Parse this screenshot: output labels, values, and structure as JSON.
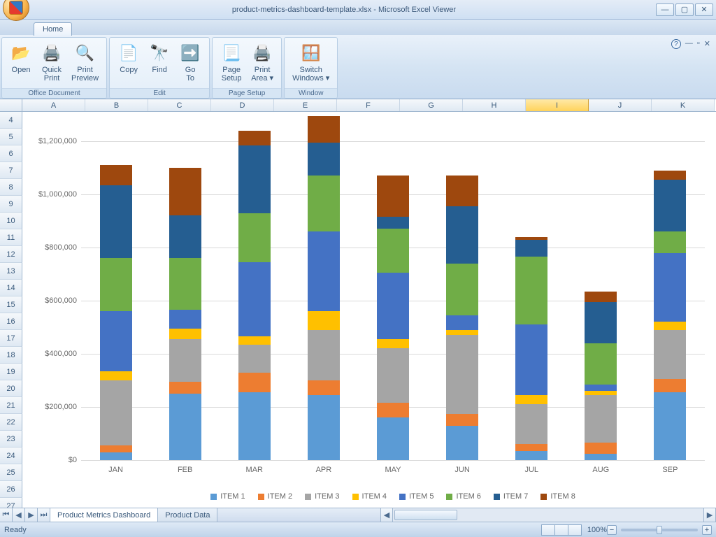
{
  "title": "product-metrics-dashboard-template.xlsx - Microsoft Excel Viewer",
  "tab": "Home",
  "groups": {
    "office_document": "Office Document",
    "edit": "Edit",
    "page_setup": "Page Setup",
    "window": "Window"
  },
  "buttons": {
    "open": "Open",
    "quick_print": "Quick\nPrint",
    "print_preview": "Print\nPreview",
    "copy": "Copy",
    "find": "Find",
    "goto": "Go\nTo",
    "page_setup": "Page\nSetup",
    "print_area": "Print\nArea ▾",
    "switch_windows": "Switch\nWindows ▾"
  },
  "columns": [
    "A",
    "B",
    "C",
    "D",
    "E",
    "F",
    "G",
    "H",
    "I",
    "J",
    "K"
  ],
  "active_column_index": 8,
  "rows": [
    "4",
    "5",
    "6",
    "7",
    "8",
    "9",
    "10",
    "11",
    "12",
    "13",
    "14",
    "15",
    "16",
    "17",
    "18",
    "19",
    "20",
    "21",
    "22",
    "23",
    "24",
    "25",
    "26",
    "27"
  ],
  "sheet_tabs": {
    "active": "Product Metrics Dashboard",
    "inactive": "Product Data"
  },
  "status": {
    "ready": "Ready",
    "zoom": "100%"
  },
  "chart_data": {
    "type": "bar",
    "stacked": true,
    "categories": [
      "JAN",
      "FEB",
      "MAR",
      "APR",
      "MAY",
      "JUN",
      "JUL",
      "AUG",
      "SEP"
    ],
    "ylabel": "",
    "ylim": [
      0,
      1300000
    ],
    "yticks": [
      0,
      200000,
      400000,
      600000,
      800000,
      1000000,
      1200000
    ],
    "ytick_labels": [
      "$0",
      "$200,000",
      "$400,000",
      "$600,000",
      "$800,000",
      "$1,000,000",
      "$1,200,000"
    ],
    "series": [
      {
        "name": "ITEM 1",
        "color": "#5b9bd5",
        "values": [
          30000,
          250000,
          255000,
          245000,
          160000,
          130000,
          35000,
          25000,
          255000
        ]
      },
      {
        "name": "ITEM 2",
        "color": "#ed7d31",
        "values": [
          25000,
          45000,
          75000,
          55000,
          55000,
          45000,
          25000,
          40000,
          50000
        ]
      },
      {
        "name": "ITEM 3",
        "color": "#a5a5a5",
        "values": [
          245000,
          160000,
          105000,
          190000,
          205000,
          295000,
          150000,
          180000,
          185000
        ]
      },
      {
        "name": "ITEM 4",
        "color": "#ffc000",
        "values": [
          35000,
          40000,
          30000,
          70000,
          35000,
          20000,
          35000,
          15000,
          30000
        ]
      },
      {
        "name": "ITEM 5",
        "color": "#4472c4",
        "values": [
          225000,
          70000,
          280000,
          300000,
          250000,
          55000,
          265000,
          25000,
          260000
        ]
      },
      {
        "name": "ITEM 6",
        "color": "#70ad47",
        "values": [
          200000,
          195000,
          185000,
          210000,
          165000,
          195000,
          255000,
          155000,
          80000
        ]
      },
      {
        "name": "ITEM 7",
        "color": "#255e91",
        "values": [
          275000,
          160000,
          255000,
          125000,
          45000,
          215000,
          65000,
          155000,
          195000
        ]
      },
      {
        "name": "ITEM 8",
        "color": "#9e480e",
        "values": [
          75000,
          180000,
          55000,
          100000,
          155000,
          115000,
          10000,
          40000,
          35000
        ]
      }
    ],
    "legend": [
      "ITEM 1",
      "ITEM 2",
      "ITEM 3",
      "ITEM 4",
      "ITEM 5",
      "ITEM 6",
      "ITEM 7",
      "ITEM 8"
    ]
  }
}
